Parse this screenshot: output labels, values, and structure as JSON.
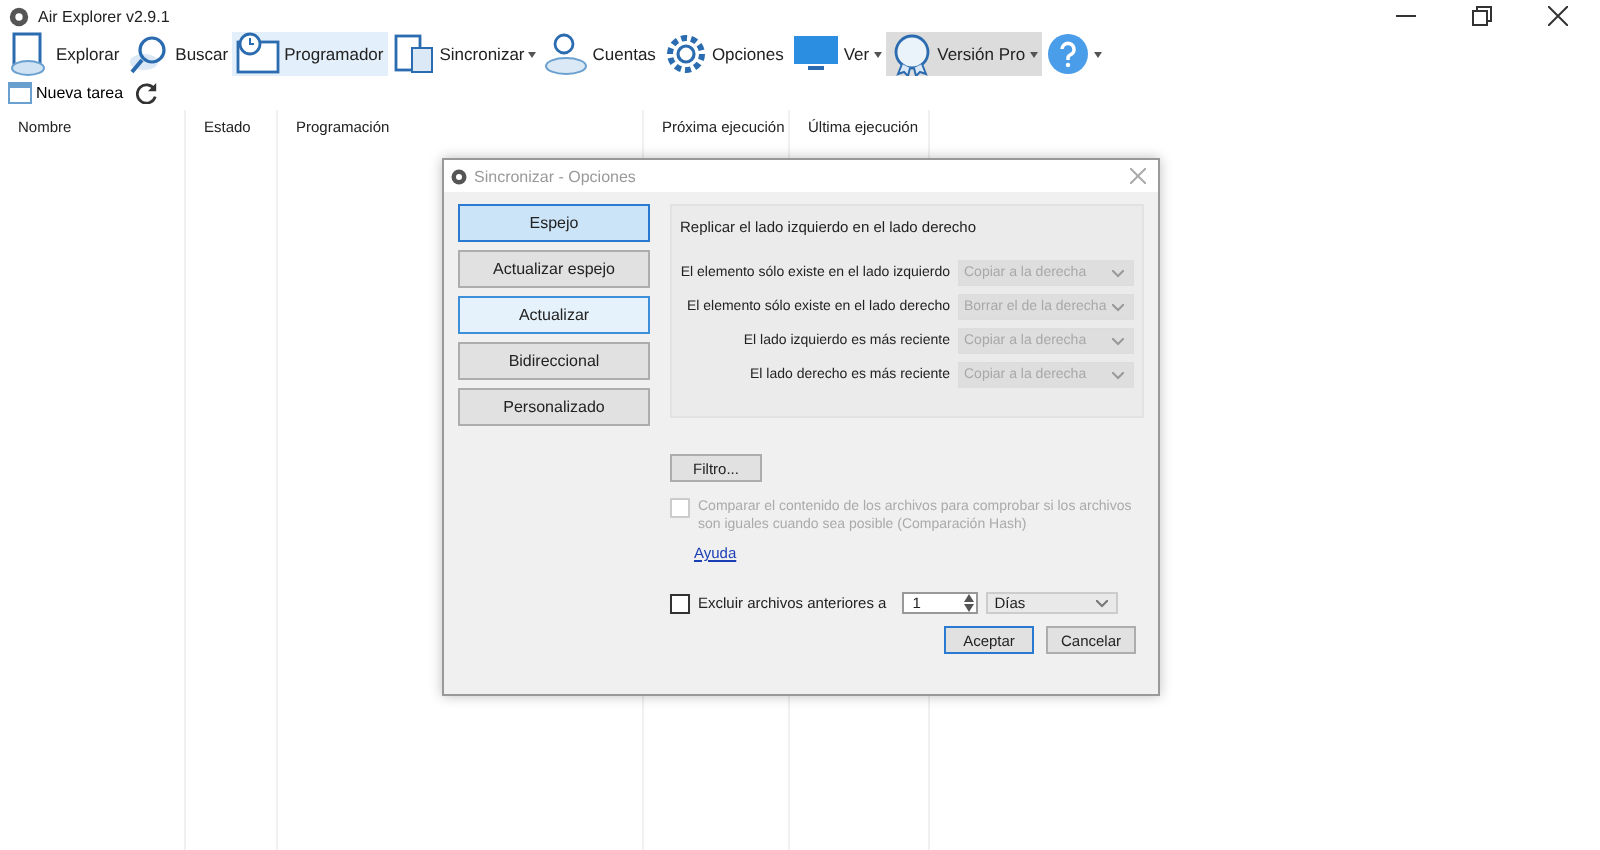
{
  "window": {
    "title": "Air Explorer v2.9.1"
  },
  "toolbar": [
    {
      "kind": "explore",
      "label": "Explorar",
      "selected": false,
      "hovered": false,
      "dropdown": false
    },
    {
      "kind": "search",
      "label": "Buscar",
      "selected": false,
      "hovered": false,
      "dropdown": false
    },
    {
      "kind": "schedule",
      "label": "Programador",
      "selected": true,
      "hovered": false,
      "dropdown": false
    },
    {
      "kind": "sync",
      "label": "Sincronizar",
      "selected": false,
      "hovered": false,
      "dropdown": true
    },
    {
      "kind": "accounts",
      "label": "Cuentas",
      "selected": false,
      "hovered": false,
      "dropdown": false
    },
    {
      "kind": "options",
      "label": "Opciones",
      "selected": false,
      "hovered": false,
      "dropdown": false
    },
    {
      "kind": "view",
      "label": "Ver",
      "selected": false,
      "hovered": false,
      "dropdown": true
    },
    {
      "kind": "pro",
      "label": "Versión Pro",
      "selected": false,
      "hovered": true,
      "dropdown": true
    },
    {
      "kind": "help",
      "selected": false,
      "hovered": false,
      "dropdown": true
    }
  ],
  "task_bar": {
    "new_task": "Nueva tarea"
  },
  "table": {
    "columns": [
      "Nombre",
      "Estado",
      "Programación",
      "Próxima ejecución",
      "Última ejecución"
    ]
  },
  "dialog": {
    "title": "Sincronizar - Opciones",
    "modes": [
      {
        "label": "Espejo",
        "selected": true,
        "hovered": false
      },
      {
        "label": "Actualizar espejo",
        "selected": false,
        "hovered": false
      },
      {
        "label": "Actualizar",
        "selected": false,
        "hovered": true
      },
      {
        "label": "Bidireccional",
        "selected": false,
        "hovered": false
      },
      {
        "label": "Personalizado",
        "selected": false,
        "hovered": false
      }
    ],
    "description": "Replicar el lado izquierdo en el lado derecho",
    "rules": [
      {
        "label": "El elemento sólo existe en el lado izquierdo",
        "value": "Copiar a la derecha",
        "disabled": true
      },
      {
        "label": "El elemento sólo existe en el lado derecho",
        "value": "Borrar el de la derecha",
        "disabled": true
      },
      {
        "label": "El lado izquierdo es más reciente",
        "value": "Copiar a la derecha",
        "disabled": true
      },
      {
        "label": "El lado derecho es más reciente",
        "value": "Copiar a la derecha",
        "disabled": true
      }
    ],
    "filter_button": "Filtro...",
    "hash_compare": {
      "label": "Comparar el contenido de los archivos para comprobar si los archivos son iguales cuando sea posible (Comparación Hash)",
      "checked": false,
      "disabled": true
    },
    "help_link": "Ayuda",
    "exclude": {
      "label": "Excluir archivos anteriores a",
      "checked": false,
      "value": "1",
      "unit": "Días"
    },
    "buttons": [
      "Aceptar",
      "Cancelar"
    ]
  }
}
